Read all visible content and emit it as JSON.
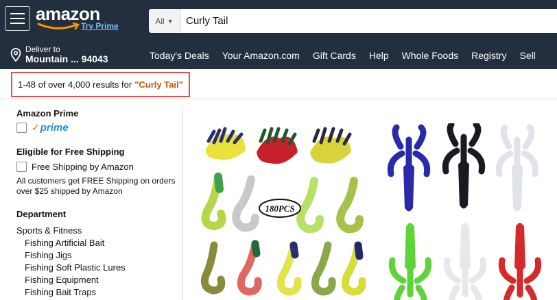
{
  "header": {
    "logo_text": "amazon",
    "logo_link": "Try Prime",
    "search": {
      "category": "All",
      "value": "Curly Tail"
    }
  },
  "nav": {
    "deliver_label": "Deliver to",
    "deliver_location": "Mountain ... 94043",
    "links": [
      "Today's Deals",
      "Your Amazon.com",
      "Gift Cards",
      "Help",
      "Whole Foods",
      "Registry",
      "Sell"
    ]
  },
  "results": {
    "summary": "1-48 of over 4,000 results for",
    "query": "\"Curly Tail\""
  },
  "sidebar": {
    "prime_title": "Amazon Prime",
    "prime_label": "prime",
    "shipping_title": "Eligible for Free Shipping",
    "shipping_option": "Free Shipping by Amazon",
    "shipping_note": "All customers get FREE Shipping on orders over $25 shipped by Amazon",
    "department_title": "Department",
    "departments": [
      "Sports & Fitness",
      "Fishing Artificial Bait",
      "Fishing Jigs",
      "Fishing Soft Plastic Lures",
      "Fishing Equipment",
      "Fishing Bait Traps"
    ]
  },
  "products": [
    {
      "badge": "180PCS"
    },
    {}
  ]
}
